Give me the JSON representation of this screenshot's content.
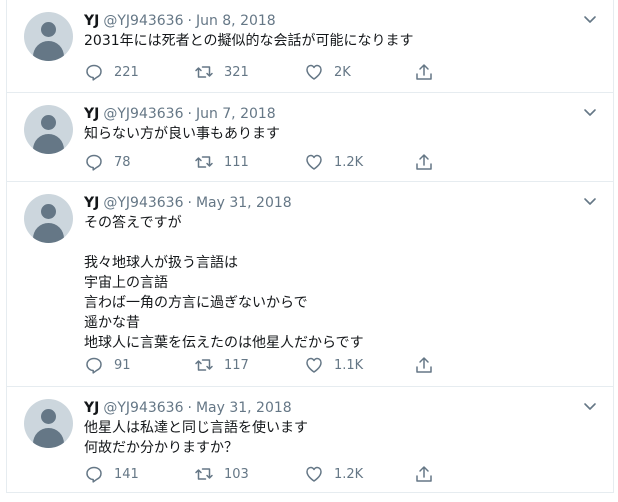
{
  "tweets": [
    {
      "name": "YJ",
      "handle": "@YJ943636",
      "separator": "·",
      "date": "Jun 8, 2018",
      "text": "2031年には死者との擬似的な会話が可能になります",
      "replies": "221",
      "retweets": "321",
      "likes": "2K"
    },
    {
      "name": "YJ",
      "handle": "@YJ943636",
      "separator": "·",
      "date": "Jun 7, 2018",
      "text": "知らない方が良い事もあります",
      "replies": "78",
      "retweets": "111",
      "likes": "1.2K"
    },
    {
      "name": "YJ",
      "handle": "@YJ943636",
      "separator": "·",
      "date": "May 31, 2018",
      "text": "その答えですが\n\n我々地球人が扱う言語は\n宇宙上の言語\n言わば一角の方言に過ぎないからで\n遥かな昔\n地球人に言葉を伝えたのは他星人だからです",
      "replies": "91",
      "retweets": "117",
      "likes": "1.1K"
    },
    {
      "name": "YJ",
      "handle": "@YJ943636",
      "separator": "·",
      "date": "May 31, 2018",
      "text": "他星人は私達と同じ言語を使います\n何故だか分かりますか？",
      "replies": "141",
      "retweets": "103",
      "likes": "1.2K"
    }
  ]
}
